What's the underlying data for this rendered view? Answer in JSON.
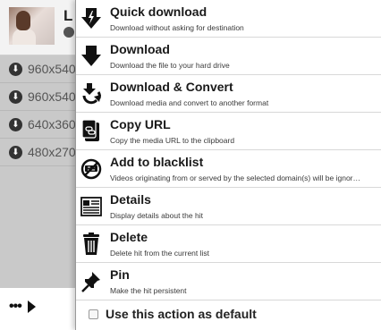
{
  "hit": {
    "title_visible": "L",
    "variants": [
      {
        "resolution": "960x540"
      },
      {
        "resolution": "960x540"
      },
      {
        "resolution": "640x360"
      },
      {
        "resolution": "480x270"
      }
    ],
    "more_label": "•••"
  },
  "menu": {
    "items": [
      {
        "id": "quick-download",
        "icon": "quick-download-icon",
        "title": "Quick download",
        "desc": "Download without asking for destination"
      },
      {
        "id": "download",
        "icon": "download-arrow-icon",
        "title": "Download",
        "desc": "Download the file to your hard drive"
      },
      {
        "id": "download-convert",
        "icon": "convert-icon",
        "title": "Download & Convert",
        "desc": "Download media and convert to another format"
      },
      {
        "id": "copy-url",
        "icon": "clipboard-icon",
        "title": "Copy URL",
        "desc": "Copy the media URL to the clipboard"
      },
      {
        "id": "blacklist",
        "icon": "blacklist-icon",
        "title": "Add to blacklist",
        "desc": "Videos originating from or served by the selected domain(s) will be ignor…"
      },
      {
        "id": "details",
        "icon": "details-icon",
        "title": "Details",
        "desc": "Display details about the hit"
      },
      {
        "id": "delete",
        "icon": "trash-icon",
        "title": "Delete",
        "desc": "Delete hit from the current list"
      },
      {
        "id": "pin",
        "icon": "pushpin-icon",
        "title": "Pin",
        "desc": "Make the hit persistent"
      }
    ],
    "default_action_label": "Use this action as default",
    "default_action_checked": false
  }
}
